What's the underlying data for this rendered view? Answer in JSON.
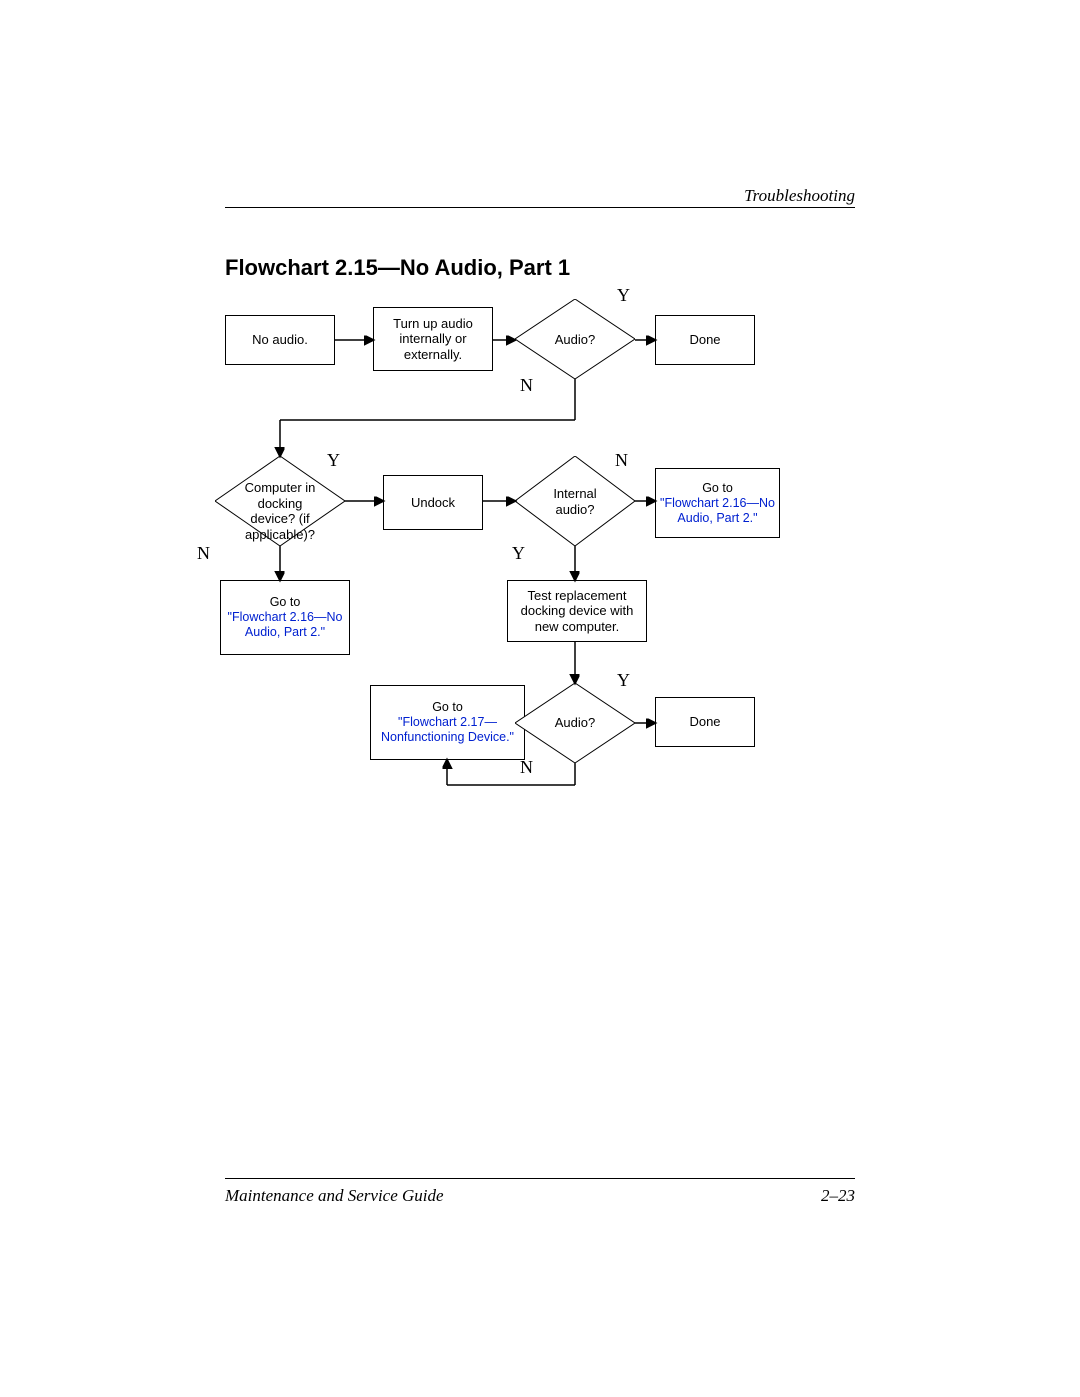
{
  "header": {
    "section": "Troubleshooting"
  },
  "title": "Flowchart 2.15—No Audio, Part 1",
  "nodes": {
    "no_audio": "No audio.",
    "turn_up": "Turn up audio internally or externally.",
    "audio1": "Audio?",
    "done1": "Done",
    "docking": "Computer in docking device? (if applicable)?",
    "undock": "Undock",
    "internal": "Internal audio?",
    "goto216a_pre": "Go to",
    "goto216a_link": "\"Flowchart 2.16—No Audio, Part 2.\"",
    "goto216b_pre": "Go to",
    "goto216b_link": "\"Flowchart 2.16—No Audio, Part 2.\"",
    "test_repl": "Test replacement docking device with new computer.",
    "goto217_pre": "Go to",
    "goto217_link": "\"Flowchart 2.17—Nonfunctioning Device.\"",
    "audio2": "Audio?",
    "done2": "Done"
  },
  "labels": {
    "Y": "Y",
    "N": "N"
  },
  "footer": {
    "left": "Maintenance and Service Guide",
    "right": "2–23"
  }
}
